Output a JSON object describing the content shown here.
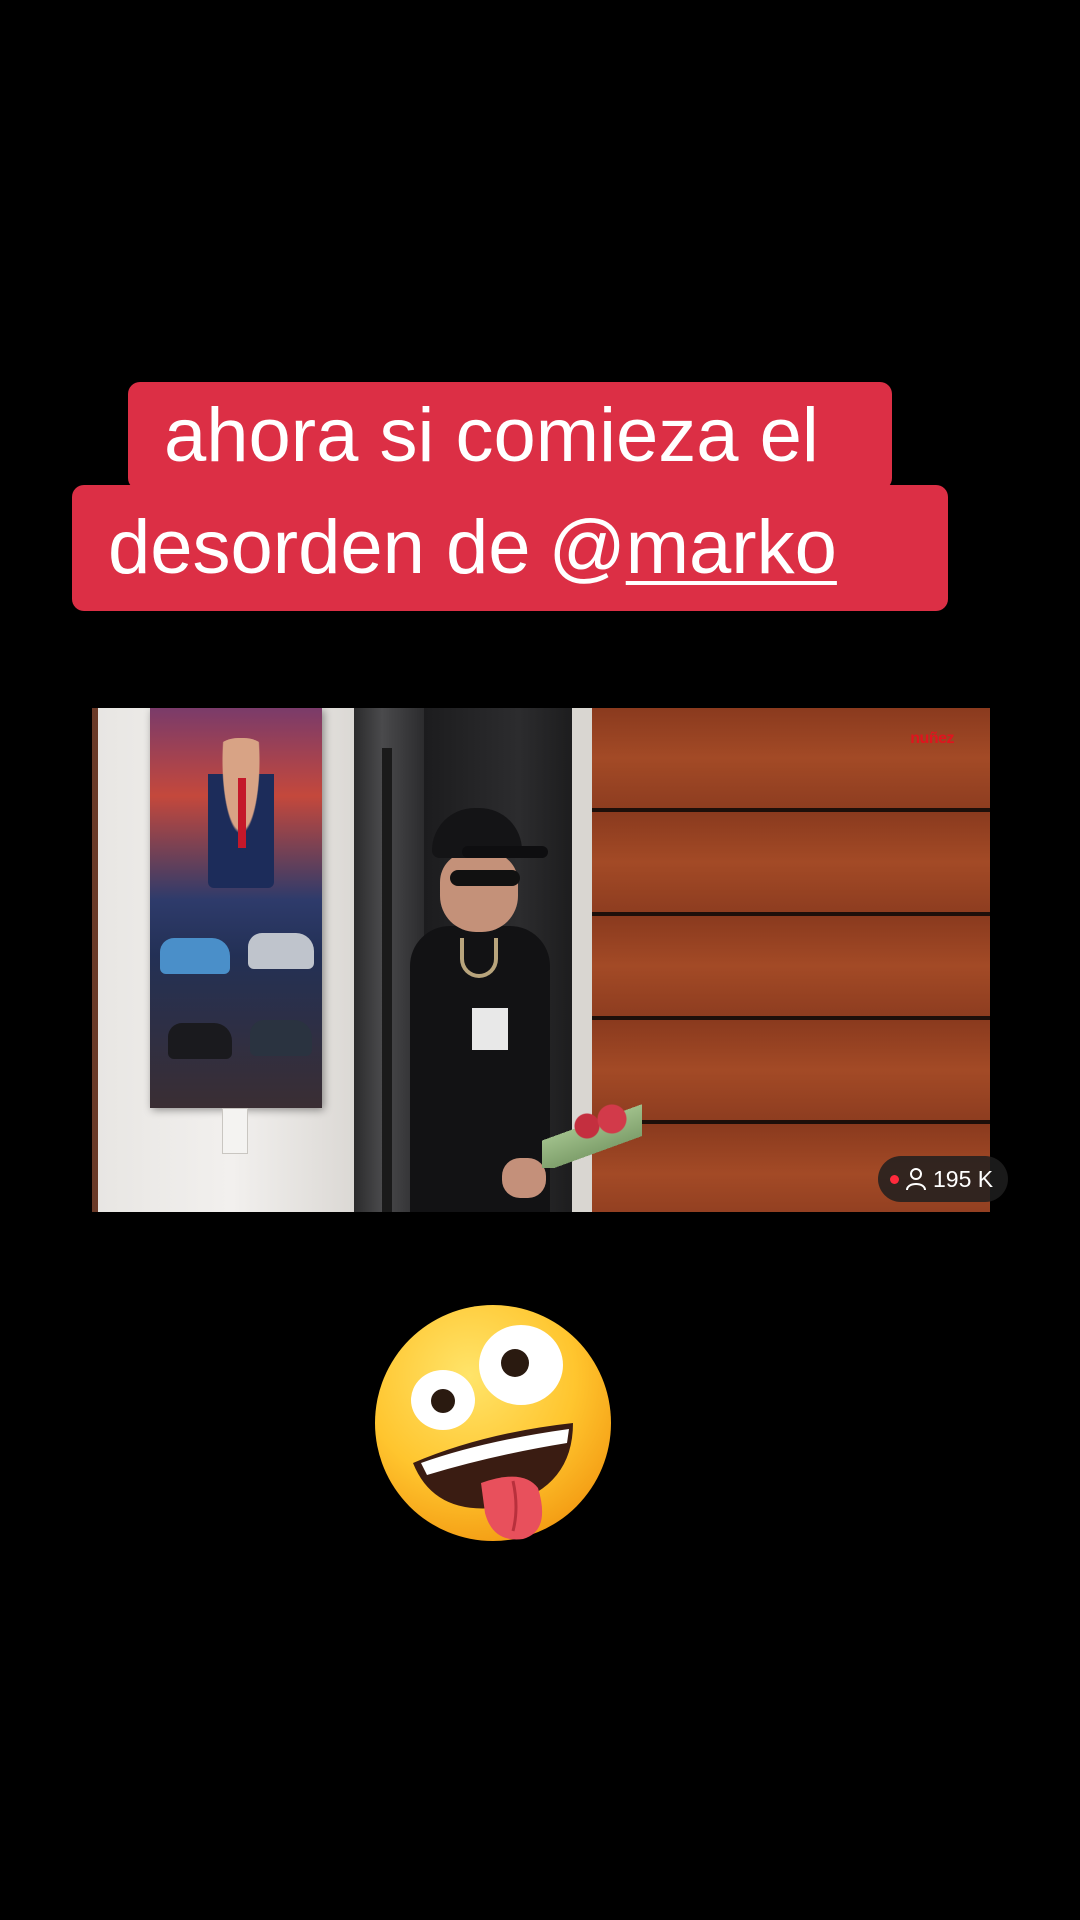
{
  "caption": {
    "line1": "ahora si comieza el",
    "line2_prefix": "desorden de ",
    "mention_at": "@",
    "mention_name": "marko"
  },
  "video": {
    "watermark": "nuñez"
  },
  "live_badge": {
    "viewer_count": "195 K",
    "icon": "person-icon"
  },
  "sticker": {
    "icon": "zany-face-emoji"
  },
  "colors": {
    "caption_bg": "#dc2f45",
    "live_dot": "#ff2a3c"
  }
}
